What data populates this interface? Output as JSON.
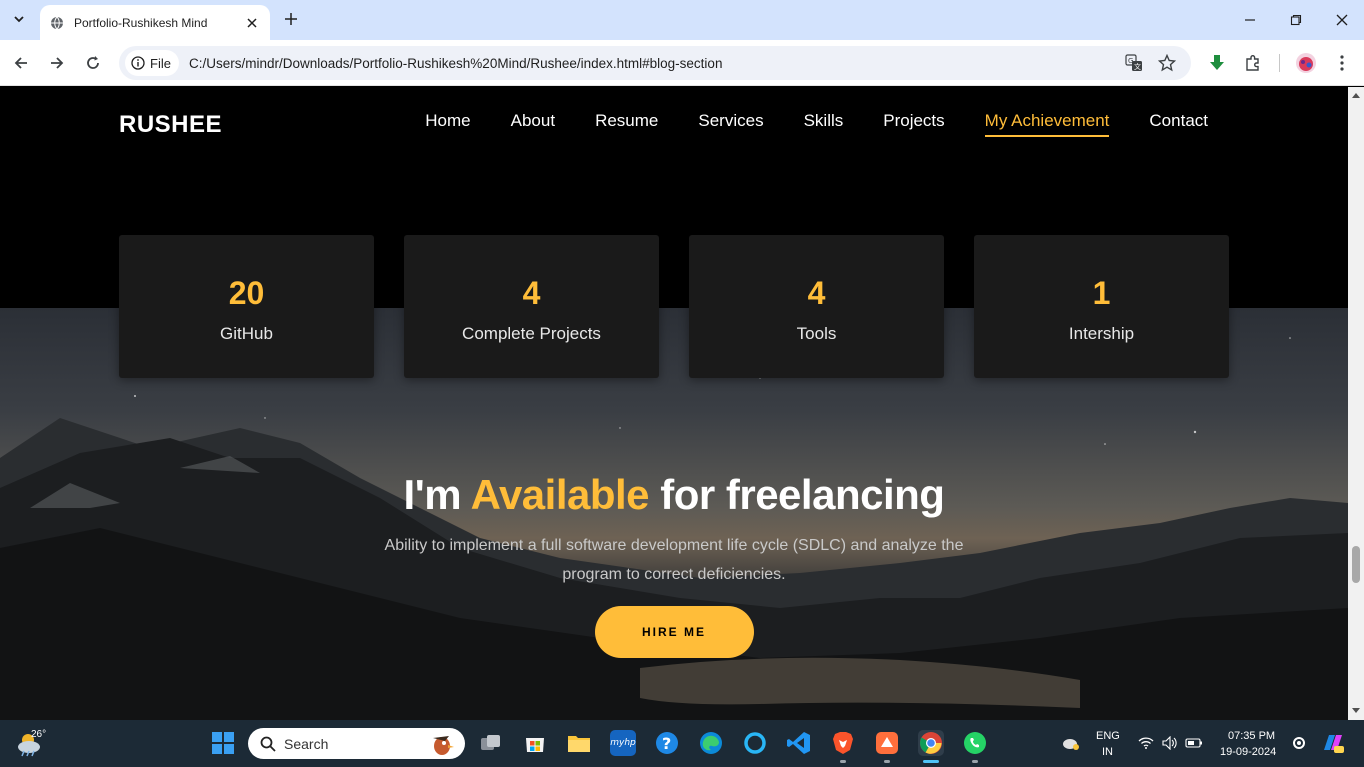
{
  "browser": {
    "tab_title": "Portfolio-Rushikesh Mind",
    "chip_label": "File",
    "url": "C:/Users/mindr/Downloads/Portfolio-Rushikesh%20Mind/Rushee/index.html#blog-section"
  },
  "site": {
    "logo": "RUSHEE",
    "nav": [
      "Home",
      "About",
      "Resume",
      "Services",
      "Skills",
      "Projects",
      "My Achievement",
      "Contact"
    ],
    "active_nav": "My Achievement",
    "stats": [
      {
        "value": "20",
        "label": "GitHub"
      },
      {
        "value": "4",
        "label": "Complete Projects"
      },
      {
        "value": "4",
        "label": "Tools"
      },
      {
        "value": "1",
        "label": "Intership"
      }
    ],
    "hire": {
      "title_prefix": "I'm ",
      "title_accent": "Available",
      "title_suffix": " for freelancing",
      "description": "Ability to implement a full software development life cycle (SDLC) and analyze the program to correct deficiencies.",
      "button": "HIRE ME"
    }
  },
  "taskbar": {
    "weather_temp": "26°",
    "search_placeholder": "Search",
    "language_top": "ENG",
    "language_bottom": "IN",
    "time": "07:35 PM",
    "date": "19-09-2024"
  },
  "colors": {
    "accent": "#ffbd39",
    "card_bg": "#1a1a1a",
    "taskbar_bg": "#1c2a36",
    "tabbar_bg": "#d3e3fd"
  }
}
